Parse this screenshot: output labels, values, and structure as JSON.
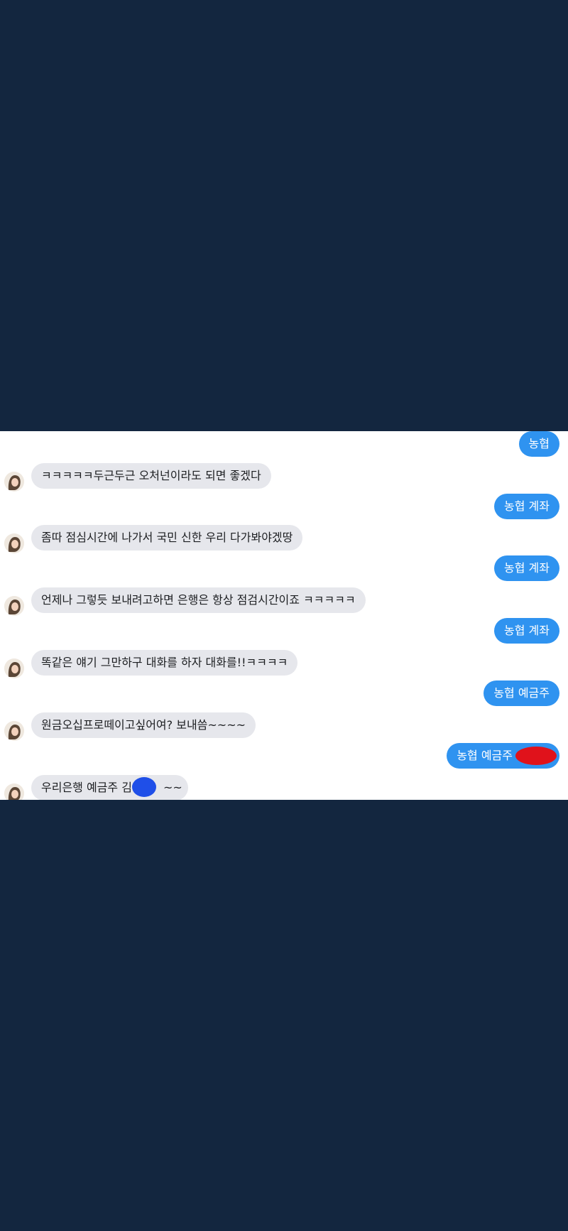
{
  "messages": [
    {
      "side": "out",
      "text": "농협"
    },
    {
      "side": "in",
      "text": "ㅋㅋㅋㅋㅋ두근두근 오처넌이라도 되면 좋겠다"
    },
    {
      "side": "out",
      "text": "농협 계좌"
    },
    {
      "side": "in",
      "text": "좀따 점심시간에 나가서 국민 신한 우리 다가봐야겠땅"
    },
    {
      "side": "out",
      "text": "농협 계좌"
    },
    {
      "side": "in",
      "text": "언제나 그렇듯 보내려고하면 은행은 항상 점검시간이죠 ㅋㅋㅋㅋㅋ"
    },
    {
      "side": "out",
      "text": "농협 계좌"
    },
    {
      "side": "in",
      "text": "똑같은 얘기 그만하구 대화를 하자 대화를!!ㅋㅋㅋㅋ"
    },
    {
      "side": "out",
      "text": "농협 예금주"
    },
    {
      "side": "in",
      "text": "원금오십프로떼이고싶어여? 보내씀~~~~"
    },
    {
      "side": "out",
      "text": "농협 예금주"
    },
    {
      "side": "in",
      "text": "우리은행 예금주 김",
      "suffix": "~~"
    }
  ],
  "colors": {
    "background": "#13263f",
    "panel": "#ffffff",
    "incoming_bubble": "#e6e7ec",
    "outgoing_bubble": "#2f93f0",
    "redaction_red": "#e0121b",
    "redaction_blue": "#1f4fe8"
  }
}
